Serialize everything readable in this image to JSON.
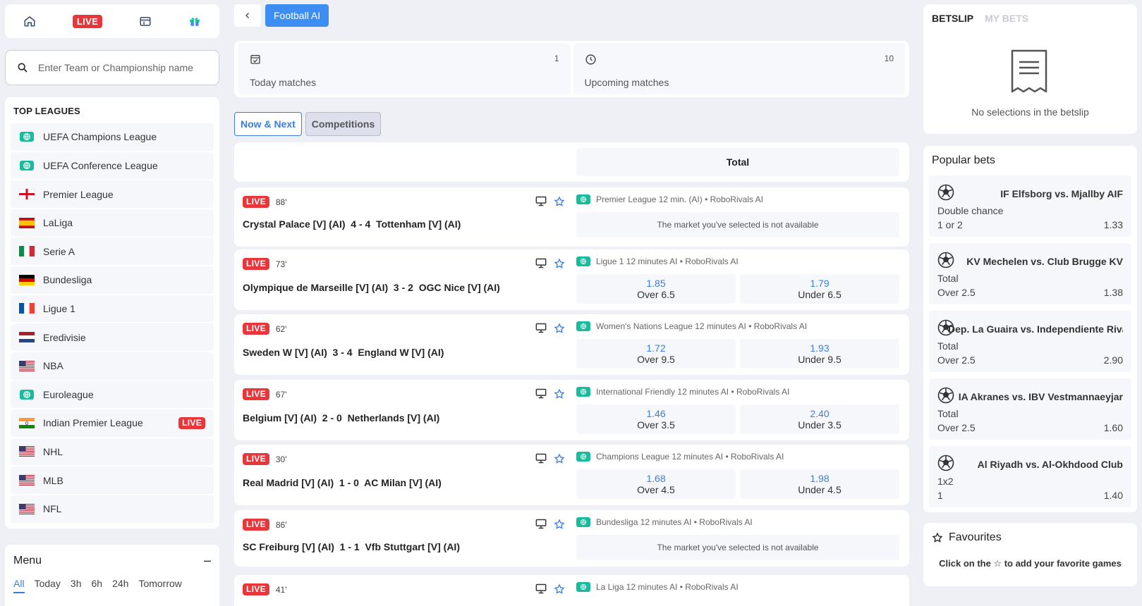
{
  "nav": {
    "live_label": "LIVE"
  },
  "search": {
    "placeholder": "Enter Team or Championship name"
  },
  "leagues": {
    "title": "TOP LEAGUES",
    "items": [
      {
        "label": "UEFA Champions League",
        "flag": "globe"
      },
      {
        "label": "UEFA Conference League",
        "flag": "globe"
      },
      {
        "label": "Premier League",
        "flag": "england"
      },
      {
        "label": "LaLiga",
        "flag": "spain"
      },
      {
        "label": "Serie A",
        "flag": "italy"
      },
      {
        "label": "Bundesliga",
        "flag": "germany"
      },
      {
        "label": "Ligue 1",
        "flag": "france"
      },
      {
        "label": "Eredivisie",
        "flag": "netherlands"
      },
      {
        "label": "NBA",
        "flag": "usa"
      },
      {
        "label": "Euroleague",
        "flag": "globe"
      },
      {
        "label": "Indian Premier League",
        "flag": "india",
        "live": "LIVE"
      },
      {
        "label": "NHL",
        "flag": "usa"
      },
      {
        "label": "MLB",
        "flag": "usa"
      },
      {
        "label": "NFL",
        "flag": "usa"
      }
    ]
  },
  "menu": {
    "title": "Menu",
    "collapse": "–",
    "tabs": [
      "All",
      "Today",
      "3h",
      "6h",
      "24h",
      "Tomorrow"
    ]
  },
  "header": {
    "tag": "Football AI"
  },
  "summary": {
    "today": {
      "label": "Today matches",
      "count": "1"
    },
    "upcoming": {
      "label": "Upcoming matches",
      "count": "10"
    }
  },
  "mode_tabs": {
    "now_next": "Now & Next",
    "competitions": "Competitions"
  },
  "table": {
    "total_header": "Total"
  },
  "matches": [
    {
      "live": "LIVE",
      "minute": "88'",
      "teams": "Crystal Palace [V] (AI)  4 - 4  Tottenham [V] (AI)",
      "competition": "Premier League 12 min. (AI) • RoboRivals AI",
      "na": "The market you've selected is not available"
    },
    {
      "live": "LIVE",
      "minute": "73'",
      "teams": "Olympique de Marseille [V] (AI)  3 - 2  OGC Nice [V] (AI)",
      "competition": "Ligue 1 12 minutes AI • RoboRivals AI",
      "odds": [
        {
          "value": "1.85",
          "label": "Over 6.5"
        },
        {
          "value": "1.79",
          "label": "Under 6.5"
        }
      ]
    },
    {
      "live": "LIVE",
      "minute": "62'",
      "teams": "Sweden W [V] (AI)  3 - 4  England W [V] (AI)",
      "competition": "Women's Nations League 12 minutes AI • RoboRivals AI",
      "odds": [
        {
          "value": "1.72",
          "label": "Over 9.5"
        },
        {
          "value": "1.93",
          "label": "Under 9.5"
        }
      ]
    },
    {
      "live": "LIVE",
      "minute": "67'",
      "teams": "Belgium [V] (AI)  2 - 0  Netherlands [V] (AI)",
      "competition": "International Friendly 12 minutes AI • RoboRivals AI",
      "odds": [
        {
          "value": "1.46",
          "label": "Over 3.5"
        },
        {
          "value": "2.40",
          "label": "Under 3.5"
        }
      ]
    },
    {
      "live": "LIVE",
      "minute": "30'",
      "teams": "Real Madrid [V] (AI)  1 - 0  AC Milan [V] (AI)",
      "competition": "Champions League 12 minutes AI • RoboRivals AI",
      "odds": [
        {
          "value": "1.68",
          "label": "Over 4.5"
        },
        {
          "value": "1.98",
          "label": "Under 4.5"
        }
      ]
    },
    {
      "live": "LIVE",
      "minute": "86'",
      "teams": "SC Freiburg [V] (AI)  1 - 1  Vfb Stuttgart [V] (AI)",
      "competition": "Bundesliga 12 minutes AI • RoboRivals AI",
      "na": "The market you've selected is not available"
    },
    {
      "live": "LIVE",
      "minute": "41'",
      "teams": "",
      "competition": "La Liga 12 minutes AI • RoboRivals AI"
    }
  ],
  "betslip": {
    "tab_active": "BETSLIP",
    "tab_inactive": "MY BETS",
    "empty": "No selections in the betslip"
  },
  "popular": {
    "title": "Popular bets",
    "items": [
      {
        "teams": "IF Elfsborg vs. Mjallby AIF",
        "market": "Double chance",
        "selection": "1 or 2",
        "odd": "1.33"
      },
      {
        "teams": "KV Mechelen vs. Club Brugge KV",
        "market": "Total",
        "selection": "Over 2.5",
        "odd": "1.38"
      },
      {
        "teams": "Dep. La Guaira vs. Independiente Rivadavia",
        "market": "Total",
        "selection": "Over 2.5",
        "odd": "2.90"
      },
      {
        "teams": "IA Akranes vs. IBV Vestmannaeyjar",
        "market": "Total",
        "selection": "Over 2.5",
        "odd": "1.60"
      },
      {
        "teams": "Al Riyadh vs. Al-Okhdood Club",
        "market": "1x2",
        "selection": "1",
        "odd": "1.40"
      }
    ]
  },
  "favourites": {
    "title": "Favourites",
    "hint": "Click on the ☆ to add your favorite games"
  },
  "colors": {
    "accent": "#3b7ddd",
    "live": "#e8363b",
    "badge": "#18bc9c",
    "tag": "#3d8ef3"
  }
}
